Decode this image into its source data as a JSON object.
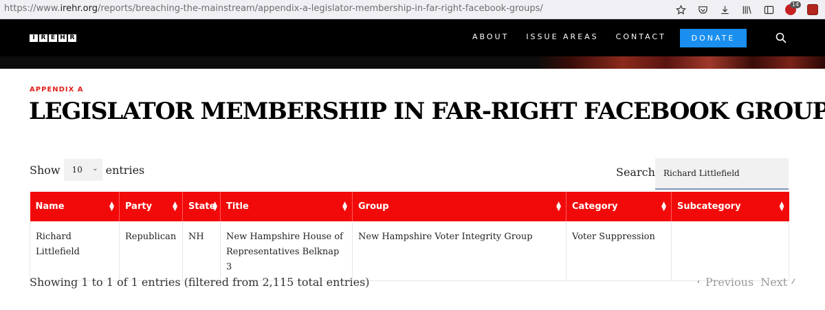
{
  "browser": {
    "url_prefix": "https://www.",
    "url_domain": "irehr.org",
    "url_path": "/reports/breaching-the-mainstream/appendix-a-legislator-membership-in-far-right-facebook-groups/",
    "extension_badge": "14",
    "icons": [
      "star-icon",
      "pocket-icon",
      "download-icon",
      "library-icon",
      "sidebar-icon",
      "extension-icon",
      "extension-icon"
    ]
  },
  "header": {
    "logo_letters": [
      "I",
      "R",
      "E",
      "H",
      "R"
    ],
    "nav": [
      "ABOUT",
      "ISSUE AREAS",
      "CONTACT"
    ],
    "donate_label": "DONATE",
    "accent_color": "#1a8ff0"
  },
  "page": {
    "eyebrow": "APPENDIX A",
    "title": "LEGISLATOR MEMBERSHIP IN FAR-RIGHT FACEBOOK GROUPS"
  },
  "table_controls": {
    "show_label": "Show",
    "page_length": "10",
    "entries_label": "entries",
    "search_label": "Search:",
    "search_value": "Richard Littlefield"
  },
  "table": {
    "header_color": "#f20a0a",
    "columns": [
      "Name",
      "Party",
      "State",
      "Title",
      "Group",
      "Category",
      "Subcategory"
    ],
    "rows": [
      [
        "Richard Littlefield",
        "Republican",
        "NH",
        "New Hampshire House of Representatives Belknap 3",
        "New Hampshire Voter Integrity Group",
        "Voter Suppression",
        ""
      ]
    ]
  },
  "footer": {
    "info": "Showing 1 to 1 of 1 entries (filtered from 2,115 total entries)",
    "previous_label": "Previous",
    "next_label": "Next",
    "prev_glyph": "‹",
    "next_glyph": "⁄"
  }
}
